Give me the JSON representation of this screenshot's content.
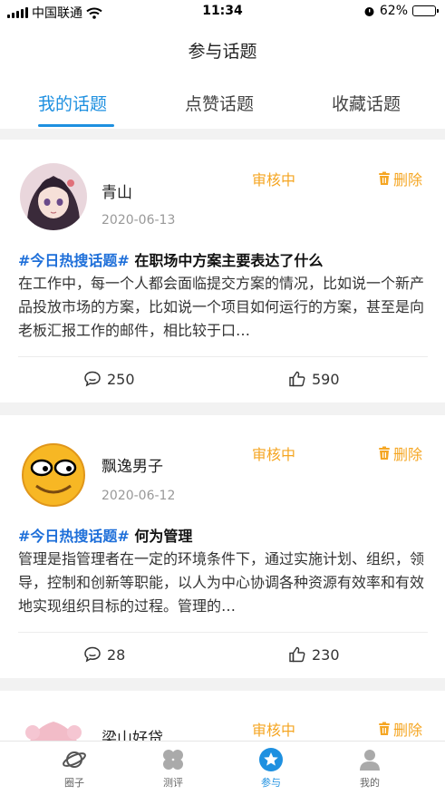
{
  "status_bar": {
    "carrier": "中国联通",
    "time": "11:34",
    "battery_percent": "62%",
    "battery_level": 0.62
  },
  "header": {
    "title": "参与话题"
  },
  "tabs": [
    {
      "label": "我的话题",
      "active": true
    },
    {
      "label": "点赞话题",
      "active": false
    },
    {
      "label": "收藏话题",
      "active": false
    }
  ],
  "posts": [
    {
      "username": "青山",
      "date": "2020-06-13",
      "status": "审核中",
      "delete_label": "删除",
      "tag": "#今日热搜话题#",
      "title": "在职场中方案主要表达了什么",
      "body": "在工作中，每一个人都会面临提交方案的情况，比如说一个新产品投放市场的方案，比如说一个项目如何运行的方案，甚至是向老板汇报工作的邮件，相比较于口…",
      "comments": "250",
      "likes": "590"
    },
    {
      "username": "飘逸男子",
      "date": "2020-06-12",
      "status": "审核中",
      "delete_label": "删除",
      "tag": "#今日热搜话题#",
      "title": "何为管理",
      "body": "管理是指管理者在一定的环境条件下，通过实施计划、组织，领导，控制和创新等职能，以人为中心协调各种资源有效率和有效地实现组织目标的过程。管理的…",
      "comments": "28",
      "likes": "230"
    },
    {
      "username": "梁山好贷",
      "status": "审核中",
      "delete_label": "删除"
    }
  ],
  "tab_bar": [
    {
      "label": "圈子",
      "icon": "planet-icon",
      "active": false
    },
    {
      "label": "测评",
      "icon": "grid-icon",
      "active": false
    },
    {
      "label": "参与",
      "icon": "star-badge-icon",
      "active": true
    },
    {
      "label": "我的",
      "icon": "person-icon",
      "active": false
    }
  ],
  "colors": {
    "accent": "#1e90e0",
    "status": "#f5a623",
    "tag": "#1e6fd9"
  }
}
